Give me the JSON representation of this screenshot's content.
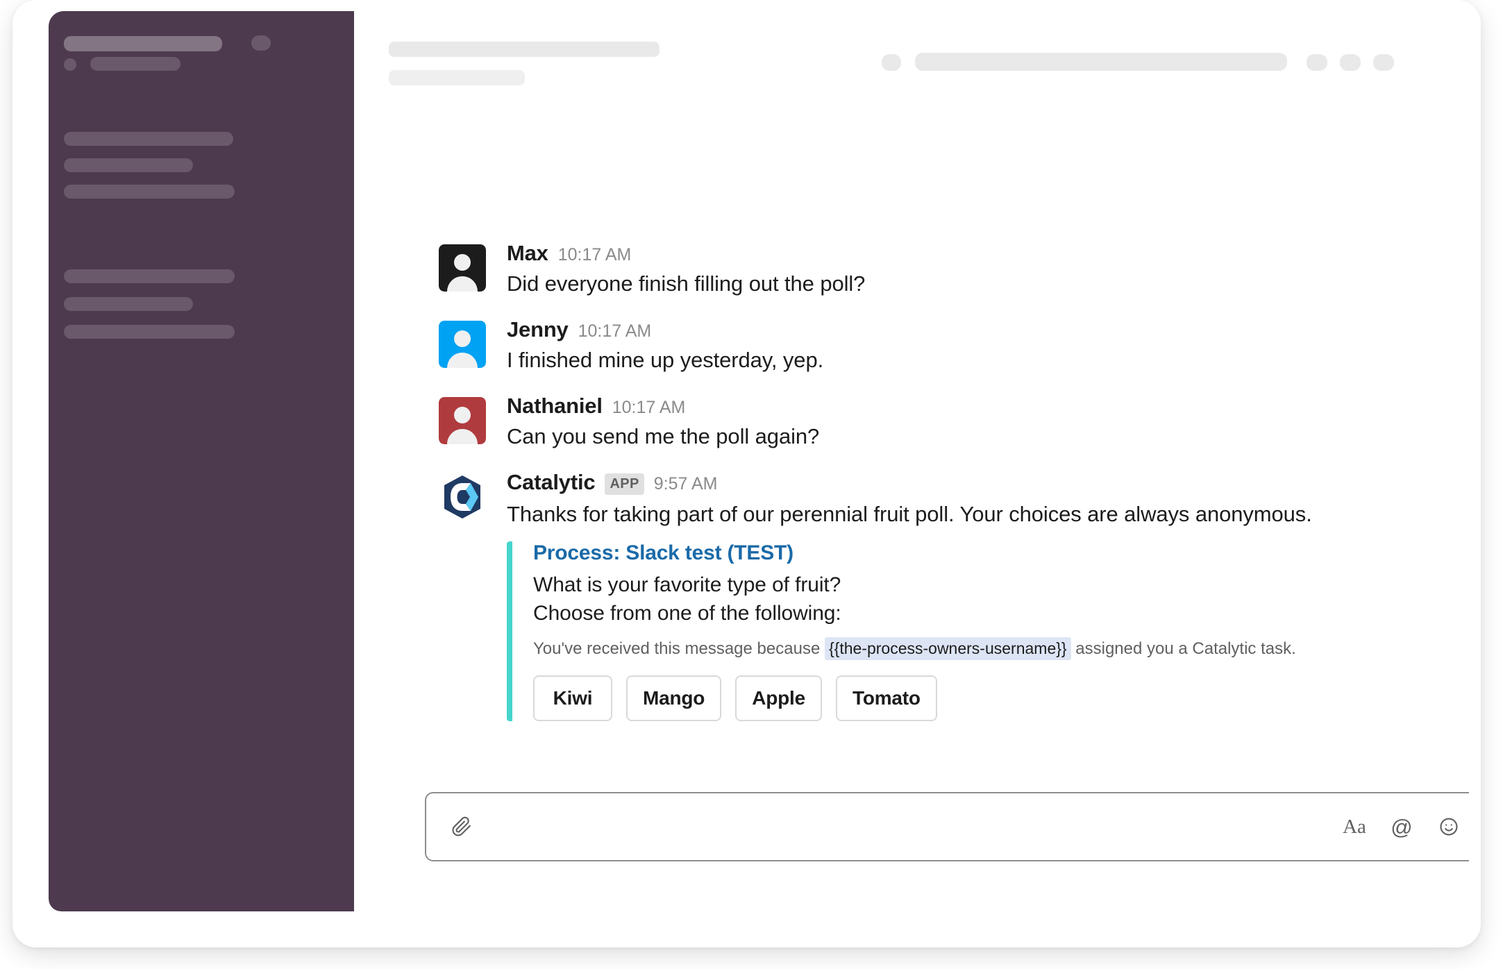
{
  "window": {
    "app_name": "Slack",
    "sidebar_color": "#4E3A4E"
  },
  "sidebar": {
    "skeleton_items": [
      {
        "name": "workspace-title-placeholder"
      },
      {
        "name": "user-status-placeholder"
      },
      {
        "name": "channel-placeholder-1"
      },
      {
        "name": "channel-placeholder-2"
      },
      {
        "name": "channel-placeholder-3"
      },
      {
        "name": "dm-placeholder-1"
      },
      {
        "name": "dm-placeholder-2"
      },
      {
        "name": "dm-placeholder-3"
      }
    ]
  },
  "header": {
    "skeleton_items": [
      {
        "name": "channel-name-placeholder"
      },
      {
        "name": "channel-topic-placeholder"
      },
      {
        "name": "search-icon-placeholder"
      },
      {
        "name": "search-bar-placeholder"
      },
      {
        "name": "header-action-placeholder-1"
      },
      {
        "name": "header-action-placeholder-2"
      },
      {
        "name": "header-action-placeholder-3"
      }
    ]
  },
  "messages": [
    {
      "sender": "Max",
      "timestamp": "10:17 AM",
      "text": "Did everyone finish filling out the poll?",
      "avatar_color": "#1D1C1D",
      "is_app": false
    },
    {
      "sender": "Jenny",
      "timestamp": "10:17 AM",
      "text": "I finished mine up yesterday, yep.",
      "avatar_color": "#00A2F3",
      "is_app": false
    },
    {
      "sender": "Nathaniel",
      "timestamp": "10:17 AM",
      "text": "Can you send me the poll again?",
      "avatar_color": "#B03B3E",
      "is_app": false
    },
    {
      "sender": "Catalytic",
      "badge": "APP",
      "timestamp": "9:57 AM",
      "text": "Thanks for taking part of our perennial fruit poll. Your choices are always anonymous.",
      "is_app": true
    }
  ],
  "attachment": {
    "accent_color": "#45D5CC",
    "title": "Process: Slack test (TEST)",
    "line1": "What is your favorite type of fruit?",
    "line2": "Choose from one of the following:",
    "footer_prefix": "You've received this message because",
    "footer_code": "{{the-process-owners-username}}",
    "footer_suffix": "assigned you a Catalytic task.",
    "buttons": [
      {
        "label": "Kiwi"
      },
      {
        "label": "Mango"
      },
      {
        "label": "Apple"
      },
      {
        "label": "Tomato"
      }
    ]
  },
  "composer": {
    "placeholder": "",
    "value": "",
    "icons": [
      {
        "name": "paperclip-icon"
      },
      {
        "name": "text-format-icon",
        "glyph": "Aa"
      },
      {
        "name": "mention-icon",
        "glyph": "@"
      },
      {
        "name": "emoji-icon"
      }
    ]
  }
}
